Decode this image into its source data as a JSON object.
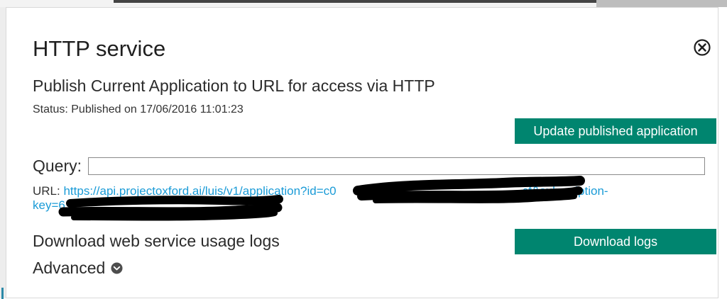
{
  "dialog": {
    "title": "HTTP service",
    "subtitle": "Publish Current Application to URL for access via HTTP",
    "status": "Status: Published on 17/06/2016 11:01:23",
    "update_button_label": "Update published application",
    "query_label": "Query:",
    "query_value": "",
    "url_prefix": "URL: ",
    "url_link_line1": "https://api.projectoxford.ai/luis/v1/application?id=c0",
    "url_link_line1_tail": "cf&subscription-",
    "url_link_line2": "key=6",
    "usage_logs_label": "Download web service usage logs",
    "download_button_label": "Download logs",
    "advanced_label": "Advanced"
  },
  "icons": {
    "close": "close-circle-icon",
    "advanced_toggle": "chevron-down-circle-icon"
  },
  "colors": {
    "primary_button": "#00856f",
    "link": "#1a9bd7",
    "redaction": "#000000"
  }
}
